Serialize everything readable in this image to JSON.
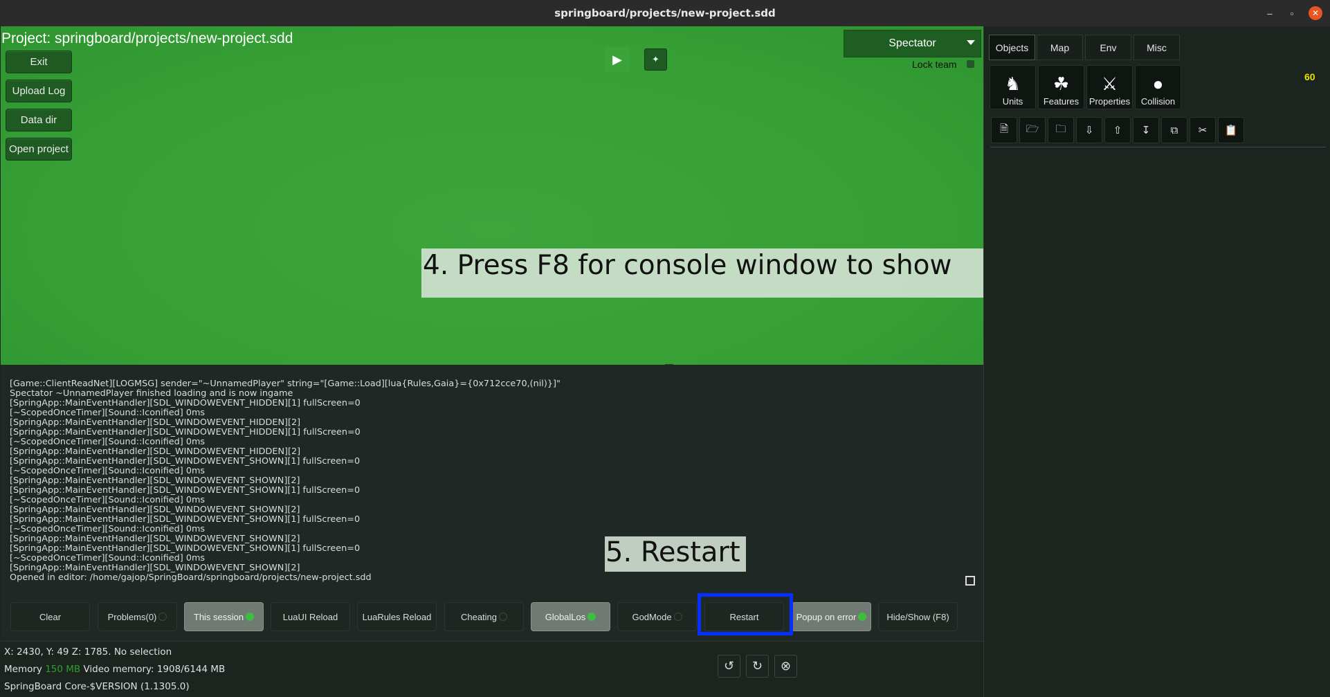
{
  "window": {
    "title": "springboard/projects/new-project.sdd"
  },
  "game": {
    "project_label": "Project: springboard/projects/new-project.sdd",
    "left_buttons": [
      "Exit",
      "Upload Log",
      "Data dir",
      "Open project"
    ],
    "play_icon": "play-icon",
    "spectator": "Spectator",
    "lock_team": "Lock team"
  },
  "overlays": {
    "step4": "4. Press F8 for console window to show",
    "step5": "5. Restart"
  },
  "console": {
    "lines": [
      "[Game::ClientReadNet][LOGMSG] sender=\"~UnnamedPlayer\" string=\"[Game::Load][lua{Rules,Gaia}={0x712cce70,(nil)}]\"",
      "Spectator ~UnnamedPlayer finished loading and is now ingame",
      "[SpringApp::MainEventHandler][SDL_WINDOWEVENT_HIDDEN][1] fullScreen=0",
      "[~ScopedOnceTimer][Sound::Iconified] 0ms",
      "[SpringApp::MainEventHandler][SDL_WINDOWEVENT_HIDDEN][2]",
      "[SpringApp::MainEventHandler][SDL_WINDOWEVENT_HIDDEN][1] fullScreen=0",
      "[~ScopedOnceTimer][Sound::Iconified] 0ms",
      "[SpringApp::MainEventHandler][SDL_WINDOWEVENT_HIDDEN][2]",
      "[SpringApp::MainEventHandler][SDL_WINDOWEVENT_SHOWN][1] fullScreen=0",
      "[~ScopedOnceTimer][Sound::Iconified] 0ms",
      "[SpringApp::MainEventHandler][SDL_WINDOWEVENT_SHOWN][2]",
      "[SpringApp::MainEventHandler][SDL_WINDOWEVENT_SHOWN][1] fullScreen=0",
      "[~ScopedOnceTimer][Sound::Iconified] 0ms",
      "[SpringApp::MainEventHandler][SDL_WINDOWEVENT_SHOWN][2]",
      "[SpringApp::MainEventHandler][SDL_WINDOWEVENT_SHOWN][1] fullScreen=0",
      "[~ScopedOnceTimer][Sound::Iconified] 0ms",
      "[SpringApp::MainEventHandler][SDL_WINDOWEVENT_SHOWN][2]",
      "[SpringApp::MainEventHandler][SDL_WINDOWEVENT_SHOWN][1] fullScreen=0",
      "[~ScopedOnceTimer][Sound::Iconified] 0ms",
      "[SpringApp::MainEventHandler][SDL_WINDOWEVENT_SHOWN][2]",
      "Opened in editor: /home/gajop/SpringBoard/springboard/projects/new-project.sdd"
    ],
    "buttons": {
      "clear": "Clear",
      "problems": "Problems(0)",
      "this_session": "This session",
      "luaui_reload": "LuaUI Reload",
      "luarules_reload": "LuaRules Reload",
      "cheating": "Cheating",
      "globallos": "GlobalLos",
      "godmode": "GodMode",
      "restart": "Restart",
      "popup_on_error": "Popup on error",
      "hide_show": "Hide/Show (F8)"
    }
  },
  "status": {
    "coords": "X: 2430, Y: 49 Z: 1785. No selection",
    "memory_label": "Memory",
    "memory_value": "150 MB",
    "video_memory": "Video memory: 1908/6144 MB",
    "version": "SpringBoard Core-$VERSION (1.1305.0)"
  },
  "right_panel": {
    "tabs": [
      "Objects",
      "Map",
      "Env",
      "Misc"
    ],
    "object_buttons": [
      "Units",
      "Features",
      "Properties",
      "Collision"
    ],
    "fps": "60"
  },
  "colors": {
    "game_green": "#36a036",
    "highlight_blue": "#0530ff",
    "fps_yellow": "#e8e200",
    "memory_green": "#2ea02e"
  }
}
